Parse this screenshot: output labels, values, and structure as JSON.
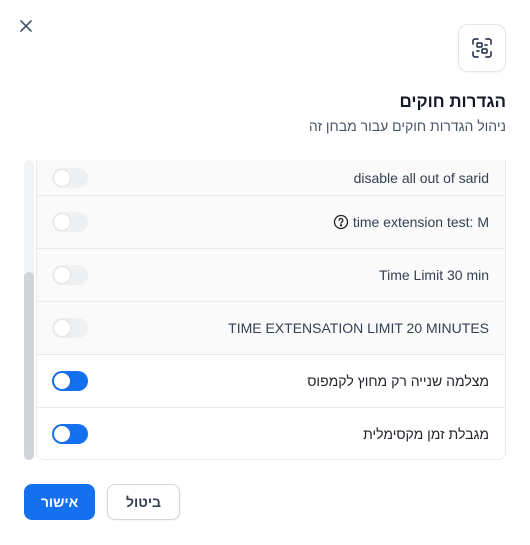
{
  "header": {
    "close_icon": "close-icon",
    "settings_icon": "rules-settings-icon",
    "title": "הגדרות חוקים",
    "subtitle": "ניהול הגדרות חוקים עבור מבחן זה"
  },
  "rules": [
    {
      "label": "disable all out of sarid",
      "enabled": false,
      "disabled": true
    },
    {
      "label": "time extension test: M",
      "enabled": false,
      "disabled": true,
      "help_icon": "question-circle-icon"
    },
    {
      "label": "Time Limit 30 min",
      "enabled": false,
      "disabled": true
    },
    {
      "label": "TIME EXTENSATION LIMIT 20 MINUTES",
      "enabled": false,
      "disabled": true
    },
    {
      "label": "מצלמה שנייה רק מחוץ לקמפוס",
      "enabled": false,
      "disabled": false
    },
    {
      "label": "מגבלת זמן מקסימלית",
      "enabled": false,
      "disabled": false
    }
  ],
  "footer": {
    "confirm_label": "אישור",
    "cancel_label": "ביטול"
  },
  "colors": {
    "accent": "#1570ef",
    "border": "#e9eaec"
  }
}
